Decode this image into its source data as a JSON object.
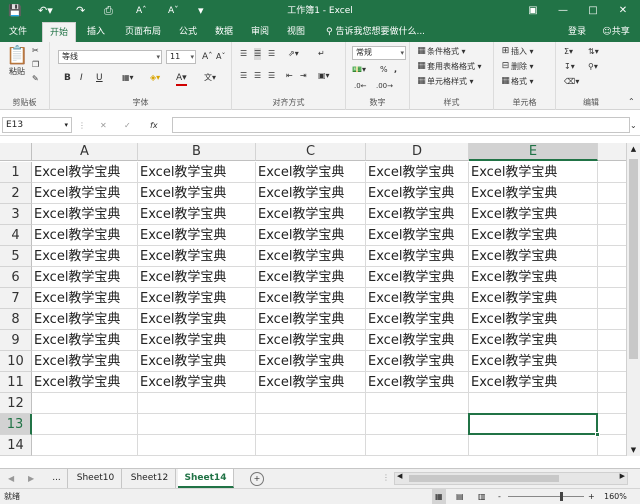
{
  "titlebar": {
    "title": "工作簿1 - Excel",
    "save_icon": "save-icon",
    "undo_icon": "undo-icon",
    "redo_icon": "redo-icon",
    "accent": "#217346"
  },
  "tabs": [
    "文件",
    "开始",
    "插入",
    "页面布局",
    "公式",
    "数据",
    "审阅",
    "视图"
  ],
  "active_tab": "开始",
  "tell_me": "告诉我您想要做什么...",
  "account": {
    "login": "登录",
    "share": "共享"
  },
  "ribbon": {
    "clipboard": {
      "label": "剪贴板",
      "paste": "粘贴"
    },
    "font": {
      "label": "字体",
      "name": "等线",
      "size": "11",
      "bold": "B",
      "italic": "I",
      "underline": "U",
      "grow": "A",
      "shrink": "A",
      "font_color": "A"
    },
    "align": {
      "label": "对齐方式"
    },
    "number": {
      "label": "数字",
      "format": "常规",
      "percent": "%",
      "comma": ","
    },
    "styles": {
      "label": "样式",
      "cond": "条件格式",
      "table": "套用表格格式",
      "cell": "单元格样式"
    },
    "cells": {
      "label": "单元格",
      "insert": "插入",
      "delete": "删除",
      "format": "格式"
    },
    "editing": {
      "label": "编辑"
    }
  },
  "formula_bar": {
    "name_box": "E13",
    "fx": "fx",
    "value": ""
  },
  "grid": {
    "columns": [
      "A",
      "B",
      "C",
      "D",
      "E"
    ],
    "rows": [
      "1",
      "2",
      "3",
      "4",
      "5",
      "6",
      "7",
      "8",
      "9",
      "10",
      "11",
      "12",
      "13",
      "14"
    ],
    "cell_text": "Excel教学宝典",
    "filled_rows": 11,
    "active_cell": "E13"
  },
  "sheets": {
    "nav": "...",
    "tabs": [
      "Sheet10",
      "Sheet12",
      "Sheet14"
    ],
    "active": "Sheet14",
    "add": "+"
  },
  "status": {
    "ready": "就绪",
    "zoom": "160%",
    "minus": "-",
    "plus": "+"
  }
}
